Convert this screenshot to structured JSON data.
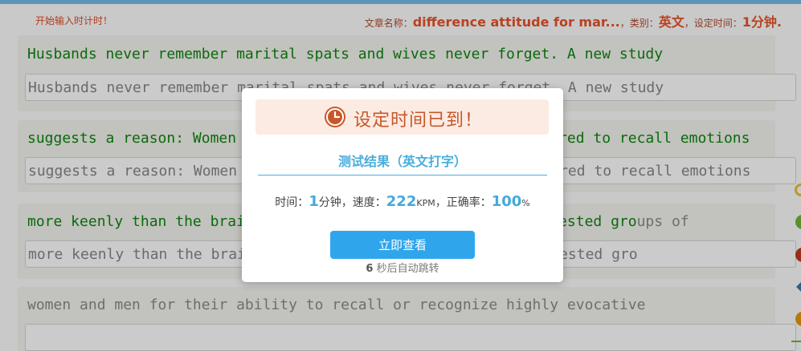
{
  "header": {
    "prompt_left": "开始输入时计时！",
    "article_label": "文章名称：",
    "article_name": "difference attitude for mar...",
    "category_label": "，类别：",
    "category": "英文",
    "time_label": "，设定时间：",
    "time": "1分钟."
  },
  "lines": [
    {
      "source": "Husbands never remember marital spats and wives never forget. A new study",
      "typed": "Husbands never remember marital spats and wives never forget. A new study"
    },
    {
      "source": "suggests a reason: Women are more likely than men to be prepared to recall emotions",
      "typed": "suggests a reason: Women are more likely than men to be prepared to recall emotions"
    },
    {
      "source_typed": "more keenly than the brain of men. Researchers in the study tested gro",
      "source_rest": "ups of",
      "typed": "more keenly than the brain of men. Researchers in the study tested gro"
    },
    {
      "source": "women and men for their ability to recall or recognize highly evocative",
      "typed": ""
    }
  ],
  "modal": {
    "title": "设定时间已到！",
    "subtitle": "测试结果（英文打字）",
    "time_label": "时间：",
    "time_value": "1",
    "time_unit": "分钟，速度：",
    "speed_value": "222",
    "speed_unit": "KPM",
    "accuracy_label": "，正确率：",
    "accuracy_value": "100",
    "accuracy_unit": "%",
    "button_label": "立即查看",
    "countdown": "6",
    "countdown_text": " 秒后自动跳转"
  },
  "colors": {
    "accent": "#2fa6ec",
    "title_orange": "#c7572a",
    "result_blue": "#43a9dc",
    "source_green": "#0a6a0a"
  },
  "icons": [
    "clock-icon",
    "side-tool-icons"
  ]
}
